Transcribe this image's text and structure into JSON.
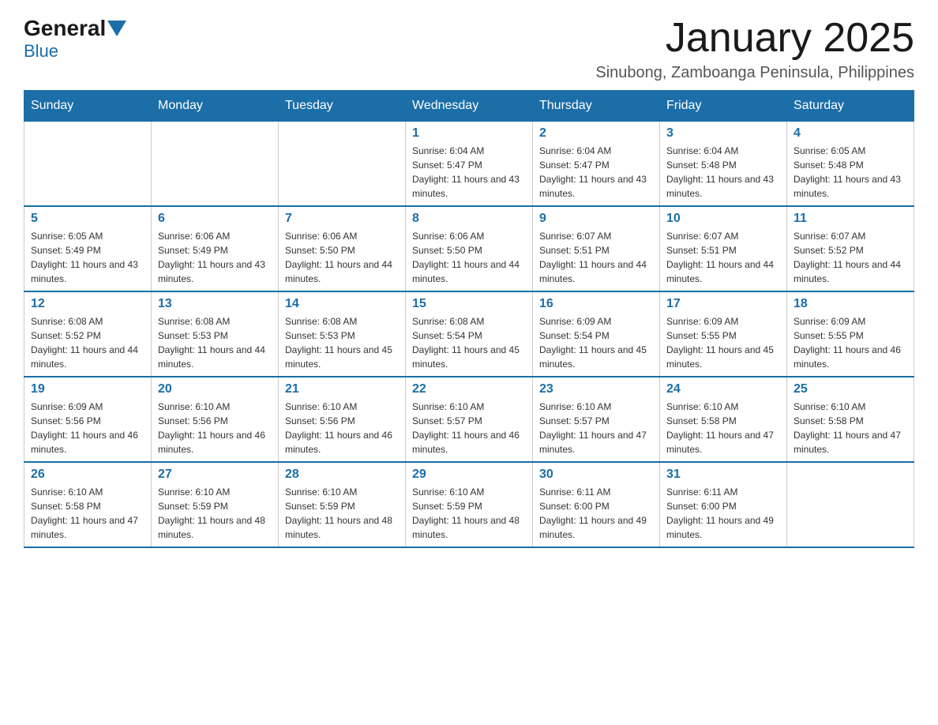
{
  "logo": {
    "general": "General",
    "blue": "Blue"
  },
  "title": "January 2025",
  "subtitle": "Sinubong, Zamboanga Peninsula, Philippines",
  "days_of_week": [
    "Sunday",
    "Monday",
    "Tuesday",
    "Wednesday",
    "Thursday",
    "Friday",
    "Saturday"
  ],
  "weeks": [
    [
      {
        "day": "",
        "info": ""
      },
      {
        "day": "",
        "info": ""
      },
      {
        "day": "",
        "info": ""
      },
      {
        "day": "1",
        "info": "Sunrise: 6:04 AM\nSunset: 5:47 PM\nDaylight: 11 hours and 43 minutes."
      },
      {
        "day": "2",
        "info": "Sunrise: 6:04 AM\nSunset: 5:47 PM\nDaylight: 11 hours and 43 minutes."
      },
      {
        "day": "3",
        "info": "Sunrise: 6:04 AM\nSunset: 5:48 PM\nDaylight: 11 hours and 43 minutes."
      },
      {
        "day": "4",
        "info": "Sunrise: 6:05 AM\nSunset: 5:48 PM\nDaylight: 11 hours and 43 minutes."
      }
    ],
    [
      {
        "day": "5",
        "info": "Sunrise: 6:05 AM\nSunset: 5:49 PM\nDaylight: 11 hours and 43 minutes."
      },
      {
        "day": "6",
        "info": "Sunrise: 6:06 AM\nSunset: 5:49 PM\nDaylight: 11 hours and 43 minutes."
      },
      {
        "day": "7",
        "info": "Sunrise: 6:06 AM\nSunset: 5:50 PM\nDaylight: 11 hours and 44 minutes."
      },
      {
        "day": "8",
        "info": "Sunrise: 6:06 AM\nSunset: 5:50 PM\nDaylight: 11 hours and 44 minutes."
      },
      {
        "day": "9",
        "info": "Sunrise: 6:07 AM\nSunset: 5:51 PM\nDaylight: 11 hours and 44 minutes."
      },
      {
        "day": "10",
        "info": "Sunrise: 6:07 AM\nSunset: 5:51 PM\nDaylight: 11 hours and 44 minutes."
      },
      {
        "day": "11",
        "info": "Sunrise: 6:07 AM\nSunset: 5:52 PM\nDaylight: 11 hours and 44 minutes."
      }
    ],
    [
      {
        "day": "12",
        "info": "Sunrise: 6:08 AM\nSunset: 5:52 PM\nDaylight: 11 hours and 44 minutes."
      },
      {
        "day": "13",
        "info": "Sunrise: 6:08 AM\nSunset: 5:53 PM\nDaylight: 11 hours and 44 minutes."
      },
      {
        "day": "14",
        "info": "Sunrise: 6:08 AM\nSunset: 5:53 PM\nDaylight: 11 hours and 45 minutes."
      },
      {
        "day": "15",
        "info": "Sunrise: 6:08 AM\nSunset: 5:54 PM\nDaylight: 11 hours and 45 minutes."
      },
      {
        "day": "16",
        "info": "Sunrise: 6:09 AM\nSunset: 5:54 PM\nDaylight: 11 hours and 45 minutes."
      },
      {
        "day": "17",
        "info": "Sunrise: 6:09 AM\nSunset: 5:55 PM\nDaylight: 11 hours and 45 minutes."
      },
      {
        "day": "18",
        "info": "Sunrise: 6:09 AM\nSunset: 5:55 PM\nDaylight: 11 hours and 46 minutes."
      }
    ],
    [
      {
        "day": "19",
        "info": "Sunrise: 6:09 AM\nSunset: 5:56 PM\nDaylight: 11 hours and 46 minutes."
      },
      {
        "day": "20",
        "info": "Sunrise: 6:10 AM\nSunset: 5:56 PM\nDaylight: 11 hours and 46 minutes."
      },
      {
        "day": "21",
        "info": "Sunrise: 6:10 AM\nSunset: 5:56 PM\nDaylight: 11 hours and 46 minutes."
      },
      {
        "day": "22",
        "info": "Sunrise: 6:10 AM\nSunset: 5:57 PM\nDaylight: 11 hours and 46 minutes."
      },
      {
        "day": "23",
        "info": "Sunrise: 6:10 AM\nSunset: 5:57 PM\nDaylight: 11 hours and 47 minutes."
      },
      {
        "day": "24",
        "info": "Sunrise: 6:10 AM\nSunset: 5:58 PM\nDaylight: 11 hours and 47 minutes."
      },
      {
        "day": "25",
        "info": "Sunrise: 6:10 AM\nSunset: 5:58 PM\nDaylight: 11 hours and 47 minutes."
      }
    ],
    [
      {
        "day": "26",
        "info": "Sunrise: 6:10 AM\nSunset: 5:58 PM\nDaylight: 11 hours and 47 minutes."
      },
      {
        "day": "27",
        "info": "Sunrise: 6:10 AM\nSunset: 5:59 PM\nDaylight: 11 hours and 48 minutes."
      },
      {
        "day": "28",
        "info": "Sunrise: 6:10 AM\nSunset: 5:59 PM\nDaylight: 11 hours and 48 minutes."
      },
      {
        "day": "29",
        "info": "Sunrise: 6:10 AM\nSunset: 5:59 PM\nDaylight: 11 hours and 48 minutes."
      },
      {
        "day": "30",
        "info": "Sunrise: 6:11 AM\nSunset: 6:00 PM\nDaylight: 11 hours and 49 minutes."
      },
      {
        "day": "31",
        "info": "Sunrise: 6:11 AM\nSunset: 6:00 PM\nDaylight: 11 hours and 49 minutes."
      },
      {
        "day": "",
        "info": ""
      }
    ]
  ]
}
